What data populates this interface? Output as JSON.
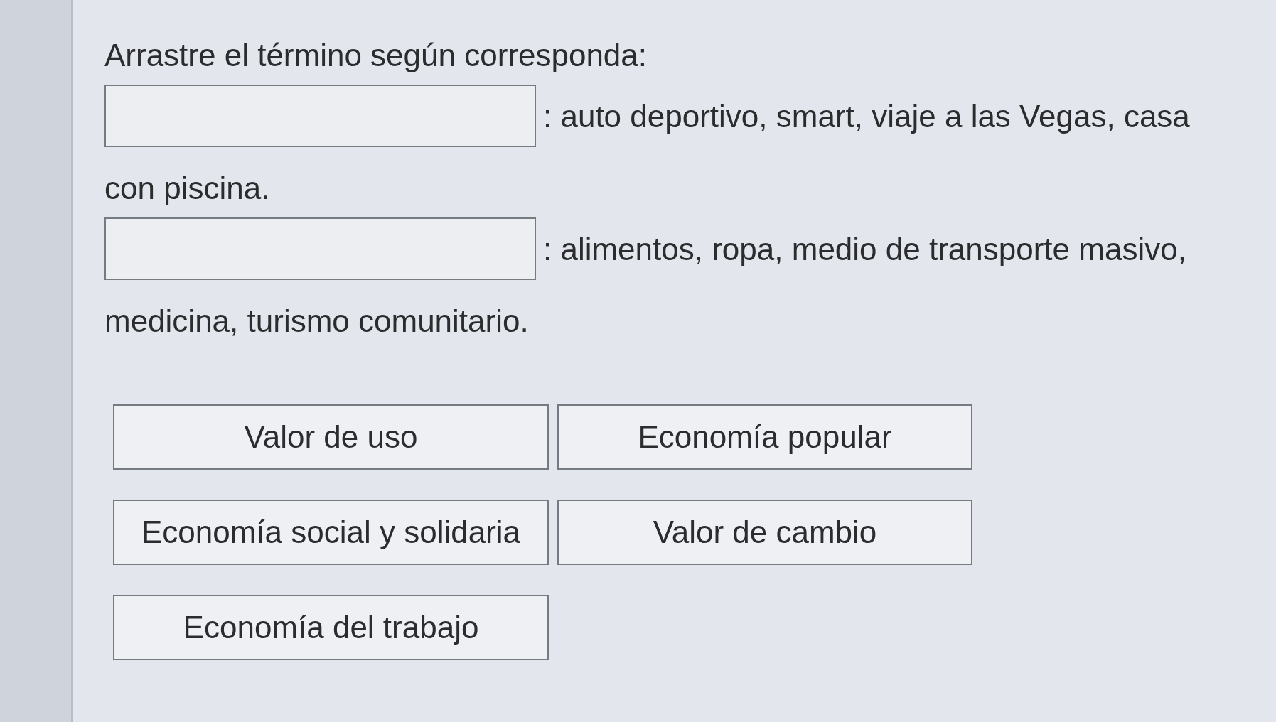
{
  "instruction": "Arrastre el término según corresponda:",
  "statements": [
    {
      "text_beside_box": ": auto deportivo, smart, viaje a las Vegas, casa",
      "text_below": "con piscina."
    },
    {
      "text_beside_box": ": alimentos, ropa, medio de transporte masivo,",
      "text_below": "medicina, turismo comunitario."
    }
  ],
  "terms": [
    {
      "label": "Valor de uso"
    },
    {
      "label": "Economía popular"
    },
    {
      "label": "Economía social y solidaria"
    },
    {
      "label": "Valor de cambio"
    },
    {
      "label": "Economía del trabajo"
    }
  ]
}
